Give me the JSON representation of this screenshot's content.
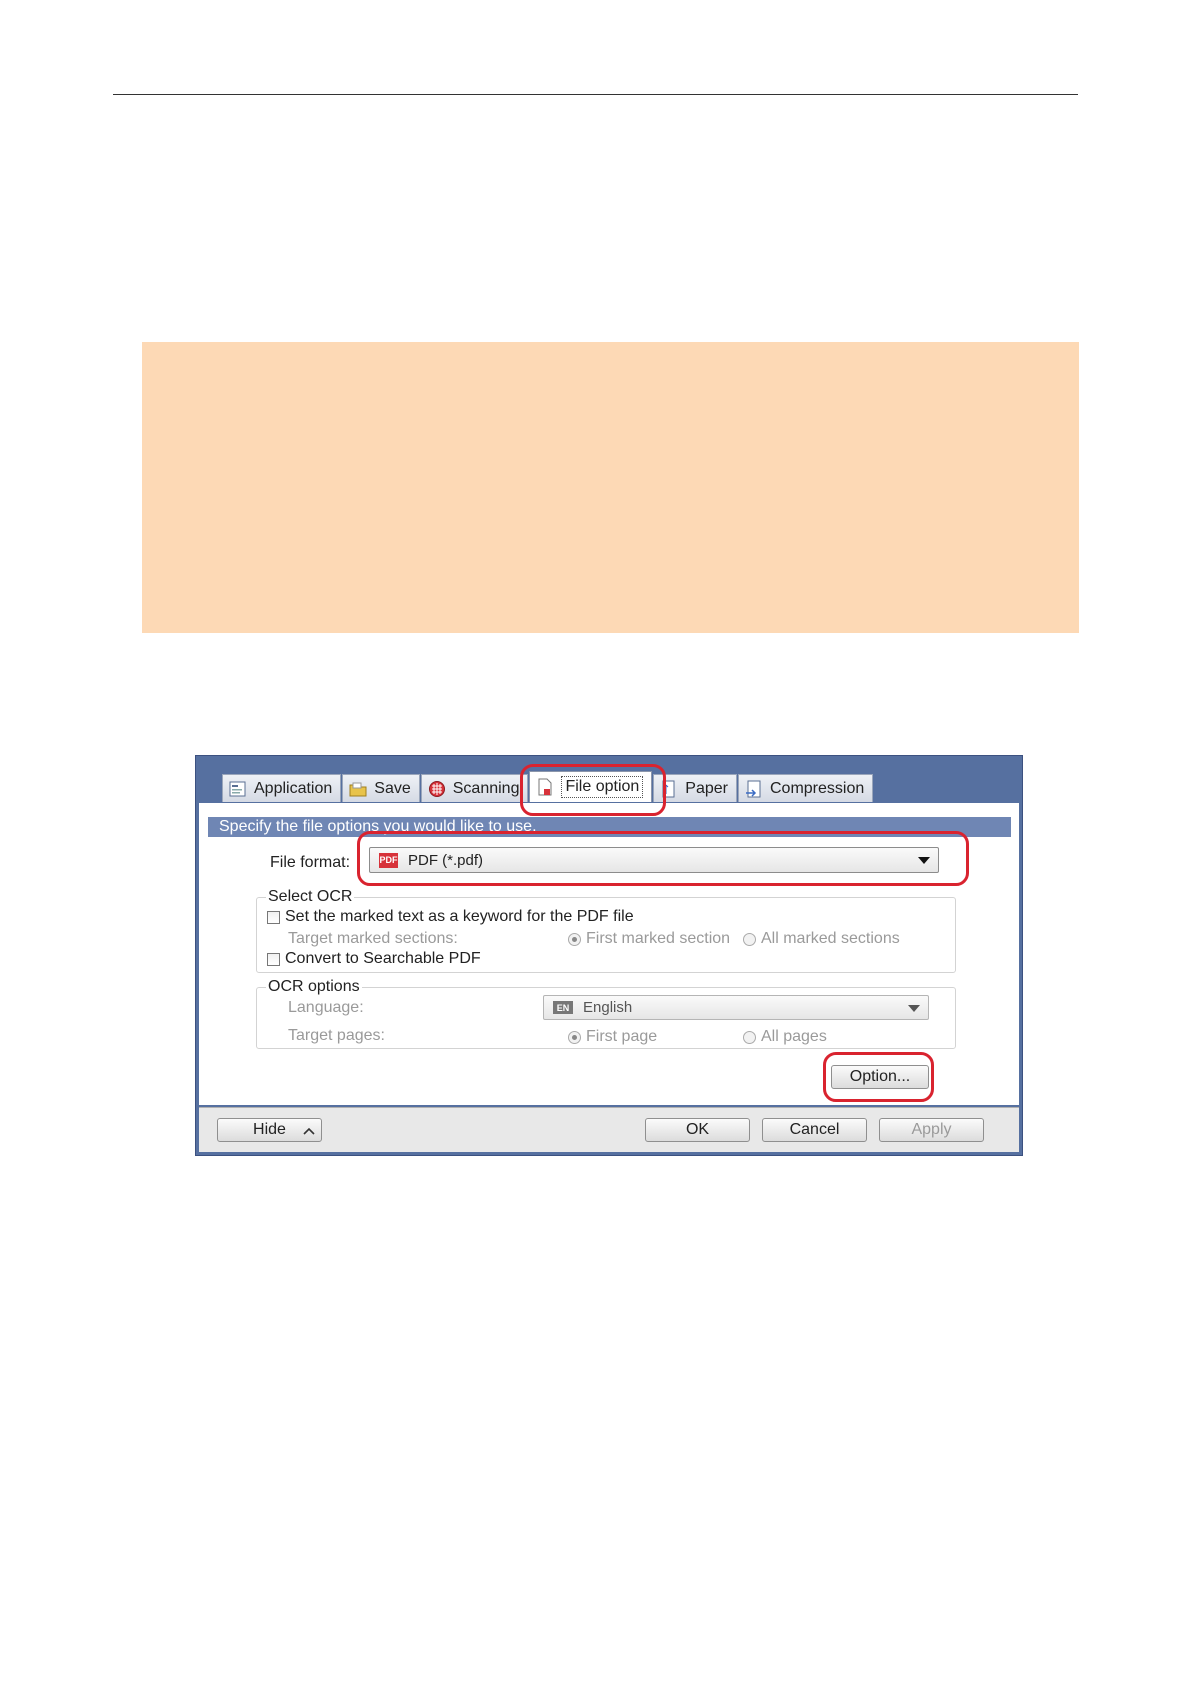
{
  "tabs": [
    {
      "label": "Application",
      "icon": "application-icon"
    },
    {
      "label": "Save",
      "icon": "folder-icon"
    },
    {
      "label": "Scanning",
      "icon": "scanning-icon"
    },
    {
      "label": "File option",
      "icon": "file-option-icon"
    },
    {
      "label": "Paper",
      "icon": "paper-icon"
    },
    {
      "label": "Compression",
      "icon": "compression-icon"
    }
  ],
  "banner": "Specify the file options you would like to use.",
  "file_format": {
    "label": "File format:",
    "value": "PDF (*.pdf)",
    "icon_text": "PDF"
  },
  "select_ocr": {
    "title": "Select OCR",
    "keyword_checkbox": "Set the marked text as a keyword for the PDF file",
    "target_label": "Target marked sections:",
    "first_marked": "First marked section",
    "all_marked": "All marked sections",
    "searchable_checkbox": "Convert to Searchable PDF"
  },
  "ocr_options": {
    "title": "OCR options",
    "language_label": "Language:",
    "language_value": "English",
    "language_icon_text": "EN",
    "target_pages_label": "Target pages:",
    "first_page": "First page",
    "all_pages": "All pages"
  },
  "option_button": "Option...",
  "footer": {
    "hide": "Hide",
    "ok": "OK",
    "cancel": "Cancel",
    "apply": "Apply"
  },
  "colors": {
    "highlight": "#d9232f",
    "note_background": "#fdd9b5",
    "dialog_frame": "#5670a0"
  }
}
